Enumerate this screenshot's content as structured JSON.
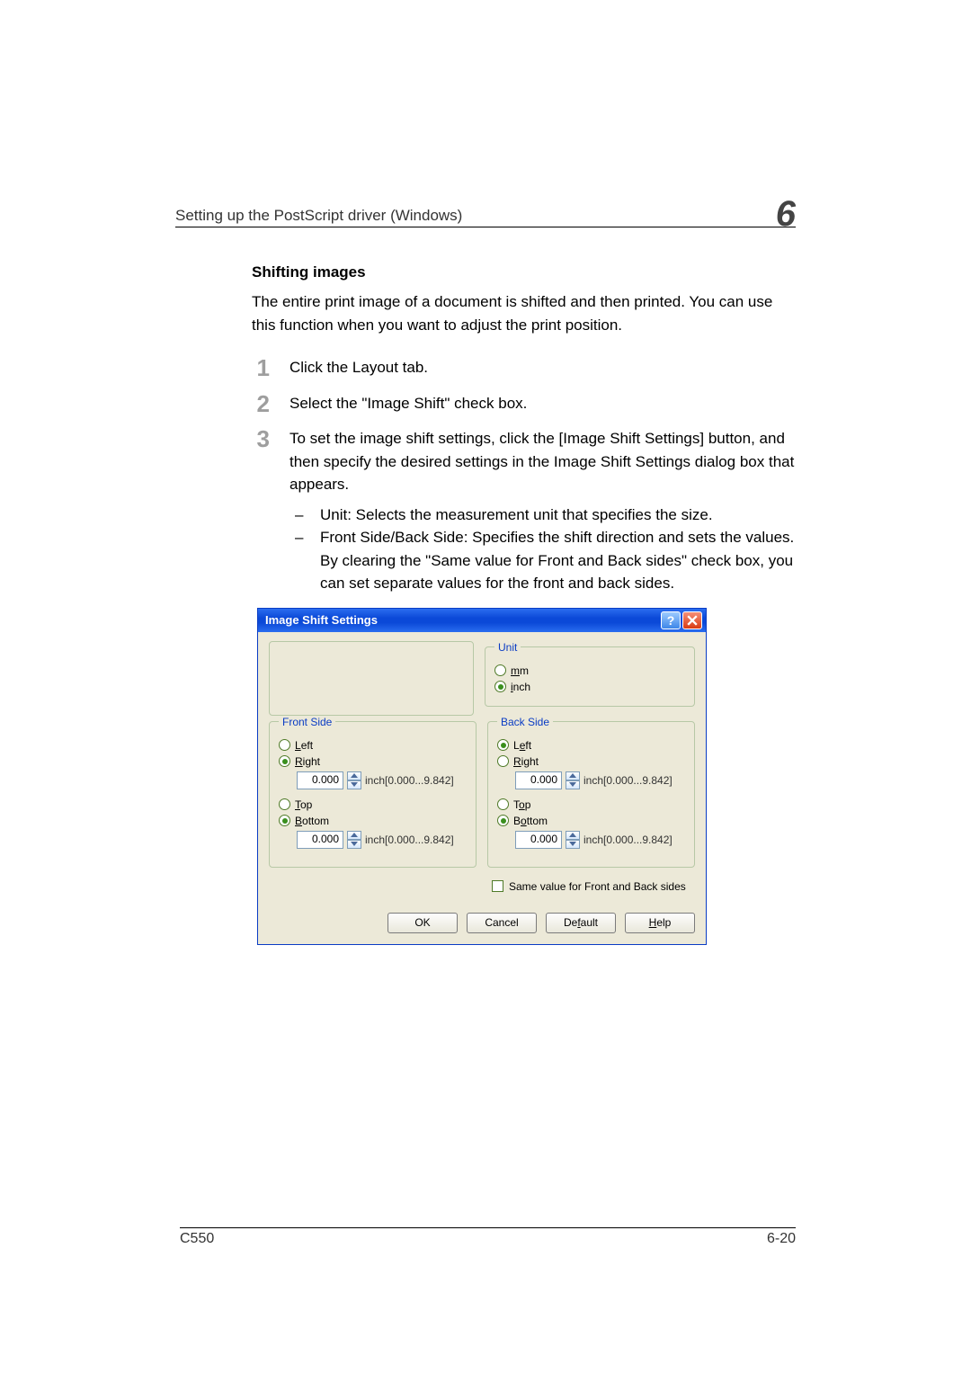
{
  "header": {
    "running_title": "Setting up the PostScript driver (Windows)",
    "chapter_number": "6"
  },
  "section": {
    "title": "Shifting images",
    "intro": "The entire print image of a document is shifted and then printed. You can use this function when you want to adjust the print position.",
    "steps": [
      "Click the Layout tab.",
      "Select the \"Image Shift\" check box.",
      "To set the image shift settings, click the [Image Shift Settings] button, and then specify the desired settings in the Image Shift Settings dialog box that appears."
    ],
    "sub_bullets": [
      "Unit: Selects the measurement unit that specifies the size.",
      "Front Side/Back Side: Specifies the shift direction and sets the values. By clearing the \"Same value for Front and Back sides\" check box, you can set separate values for the front and back sides."
    ]
  },
  "dialog": {
    "title": "Image Shift Settings",
    "unit": {
      "legend": "Unit",
      "mm_label": "mm",
      "inch_label": "inch",
      "selected": "inch"
    },
    "front": {
      "legend": "Front Side",
      "left": "Left",
      "right": "Right",
      "top": "Top",
      "bottom": "Bottom",
      "h_sel": "right",
      "v_sel": "bottom",
      "h_value": "0.000",
      "v_value": "0.000",
      "range": "inch[0.000...9.842]"
    },
    "back": {
      "legend": "Back Side",
      "left": "Left",
      "right": "Right",
      "top": "Top",
      "bottom": "Bottom",
      "h_sel": "left",
      "v_sel": "bottom",
      "h_value": "0.000",
      "v_value": "0.000",
      "range": "inch[0.000...9.842]"
    },
    "same_value_label": "Same value for Front and Back sides",
    "same_value_checked": false,
    "buttons": {
      "ok": "OK",
      "cancel": "Cancel",
      "default": "Default",
      "help": "Help"
    }
  },
  "footer": {
    "model": "C550",
    "page": "6-20"
  }
}
